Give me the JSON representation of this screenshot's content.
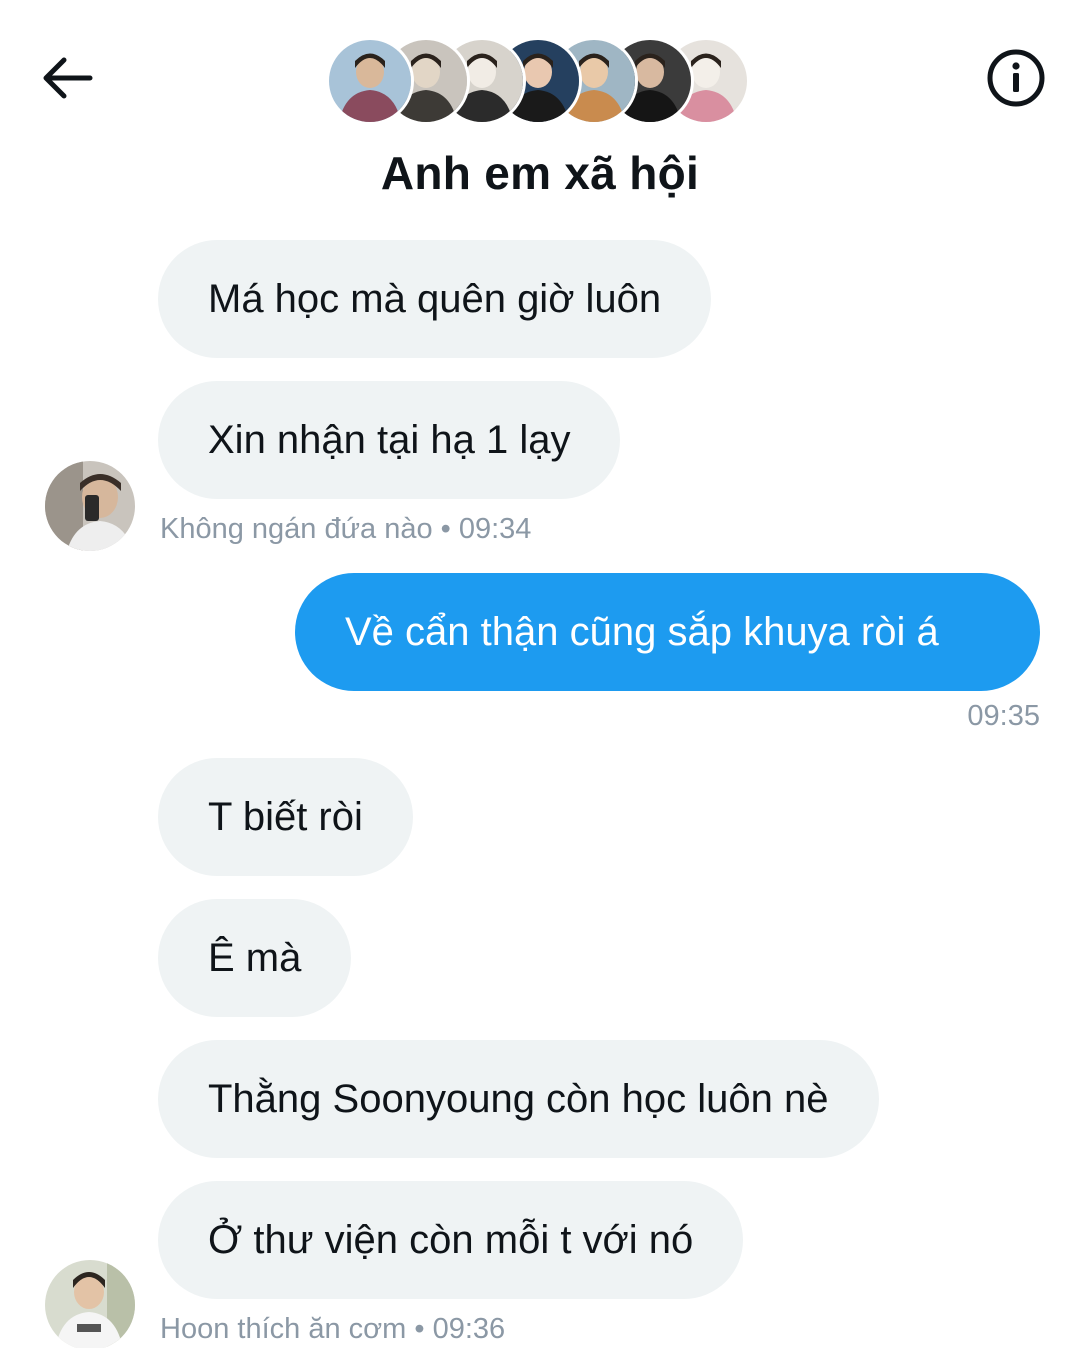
{
  "header": {
    "title": "Anh em xã hội",
    "back_icon": "arrow-left-icon",
    "info_icon": "info-circle-icon",
    "participant_avatars": [
      {
        "name": "participant-avatar-1",
        "colors": [
          "#a8c3d8",
          "#8a4b5e",
          "#d9b89a"
        ]
      },
      {
        "name": "participant-avatar-2",
        "colors": [
          "#c9c4bd",
          "#3d3a36",
          "#e2d6c6"
        ]
      },
      {
        "name": "participant-avatar-3",
        "colors": [
          "#d7d3cc",
          "#2b2b2b",
          "#f1ece5"
        ]
      },
      {
        "name": "participant-avatar-4",
        "colors": [
          "#25405f",
          "#1a1a1a",
          "#e9c8b0"
        ]
      },
      {
        "name": "participant-avatar-5",
        "colors": [
          "#9fb6c4",
          "#c98b4e",
          "#e9c9a8"
        ]
      },
      {
        "name": "participant-avatar-6",
        "colors": [
          "#3b3b3b",
          "#151515",
          "#d8b9a0"
        ]
      },
      {
        "name": "participant-avatar-7",
        "colors": [
          "#e6e2dd",
          "#d98fa0",
          "#f3efe9"
        ]
      }
    ]
  },
  "messages": [
    {
      "id": "m1",
      "direction": "in",
      "text": "Má học mà quên giờ luôn"
    },
    {
      "id": "m2",
      "direction": "in",
      "text": "Xin nhận tại hạ 1 lạy"
    },
    {
      "id": "m3",
      "direction": "out",
      "text": "Về cẩn thận cũng sắp khuya ròi á"
    },
    {
      "id": "m4",
      "direction": "in",
      "text": "T biết ròi"
    },
    {
      "id": "m5",
      "direction": "in",
      "text": "Ê mà"
    },
    {
      "id": "m6",
      "direction": "in",
      "text": "Thằng Soonyoung còn học luôn nè"
    },
    {
      "id": "m7",
      "direction": "in",
      "text": "Ở thư viện còn mỗi t với nó"
    }
  ],
  "meta": {
    "group1": "Không ngán đứa nào • 09:34",
    "sent": "09:35",
    "group2": "Hoon thích ăn cơm • 09:36"
  },
  "colors": {
    "accent_blue": "#1d9bf0",
    "incoming_bubble": "#eff3f4",
    "meta_text": "#8b98a5"
  }
}
